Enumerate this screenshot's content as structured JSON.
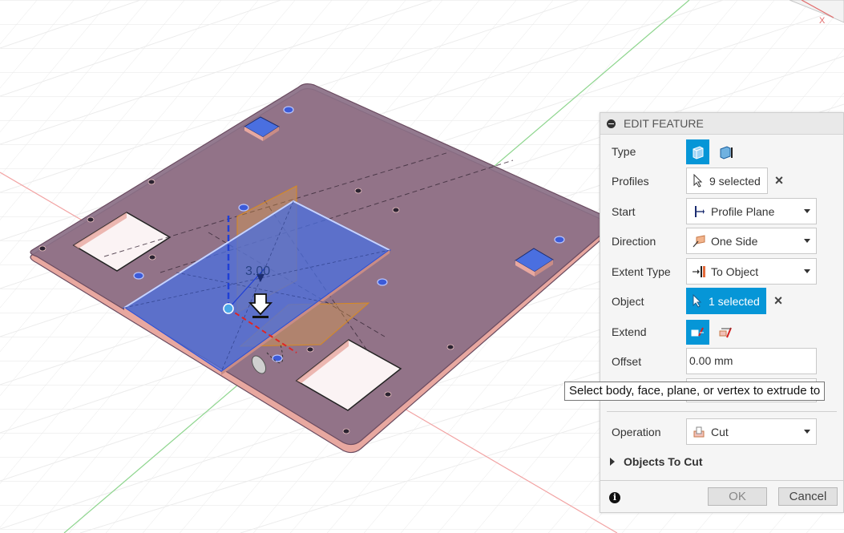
{
  "viewport": {
    "dimension_label": "3.00",
    "view_cube_axis_label": "X"
  },
  "panel": {
    "title": "EDIT FEATURE",
    "type": {
      "label": "Type"
    },
    "profiles": {
      "label": "Profiles",
      "value": "9 selected"
    },
    "start": {
      "label": "Start",
      "value": "Profile Plane"
    },
    "direction": {
      "label": "Direction",
      "value": "One Side"
    },
    "extent_type": {
      "label": "Extent Type",
      "value": "To Object"
    },
    "object": {
      "label": "Object",
      "value": "1 selected"
    },
    "extend": {
      "label": "Extend"
    },
    "offset": {
      "label": "Offset",
      "value": "0.00 mm"
    },
    "operation": {
      "label": "Operation",
      "value": "Cut"
    },
    "objects_to_cut": {
      "label": "Objects To Cut"
    },
    "ok_label": "OK",
    "cancel_label": "Cancel",
    "info_glyph": "i"
  },
  "tooltip": {
    "text": "Select body, face, plane, or vertex to extrude to"
  },
  "colors": {
    "accent": "#0696d7",
    "body_fill": "#8a6f85",
    "body_edge": "#e8a8a0",
    "selection_blue": "#4a6fe0",
    "plane_orange": "#e8a040"
  }
}
